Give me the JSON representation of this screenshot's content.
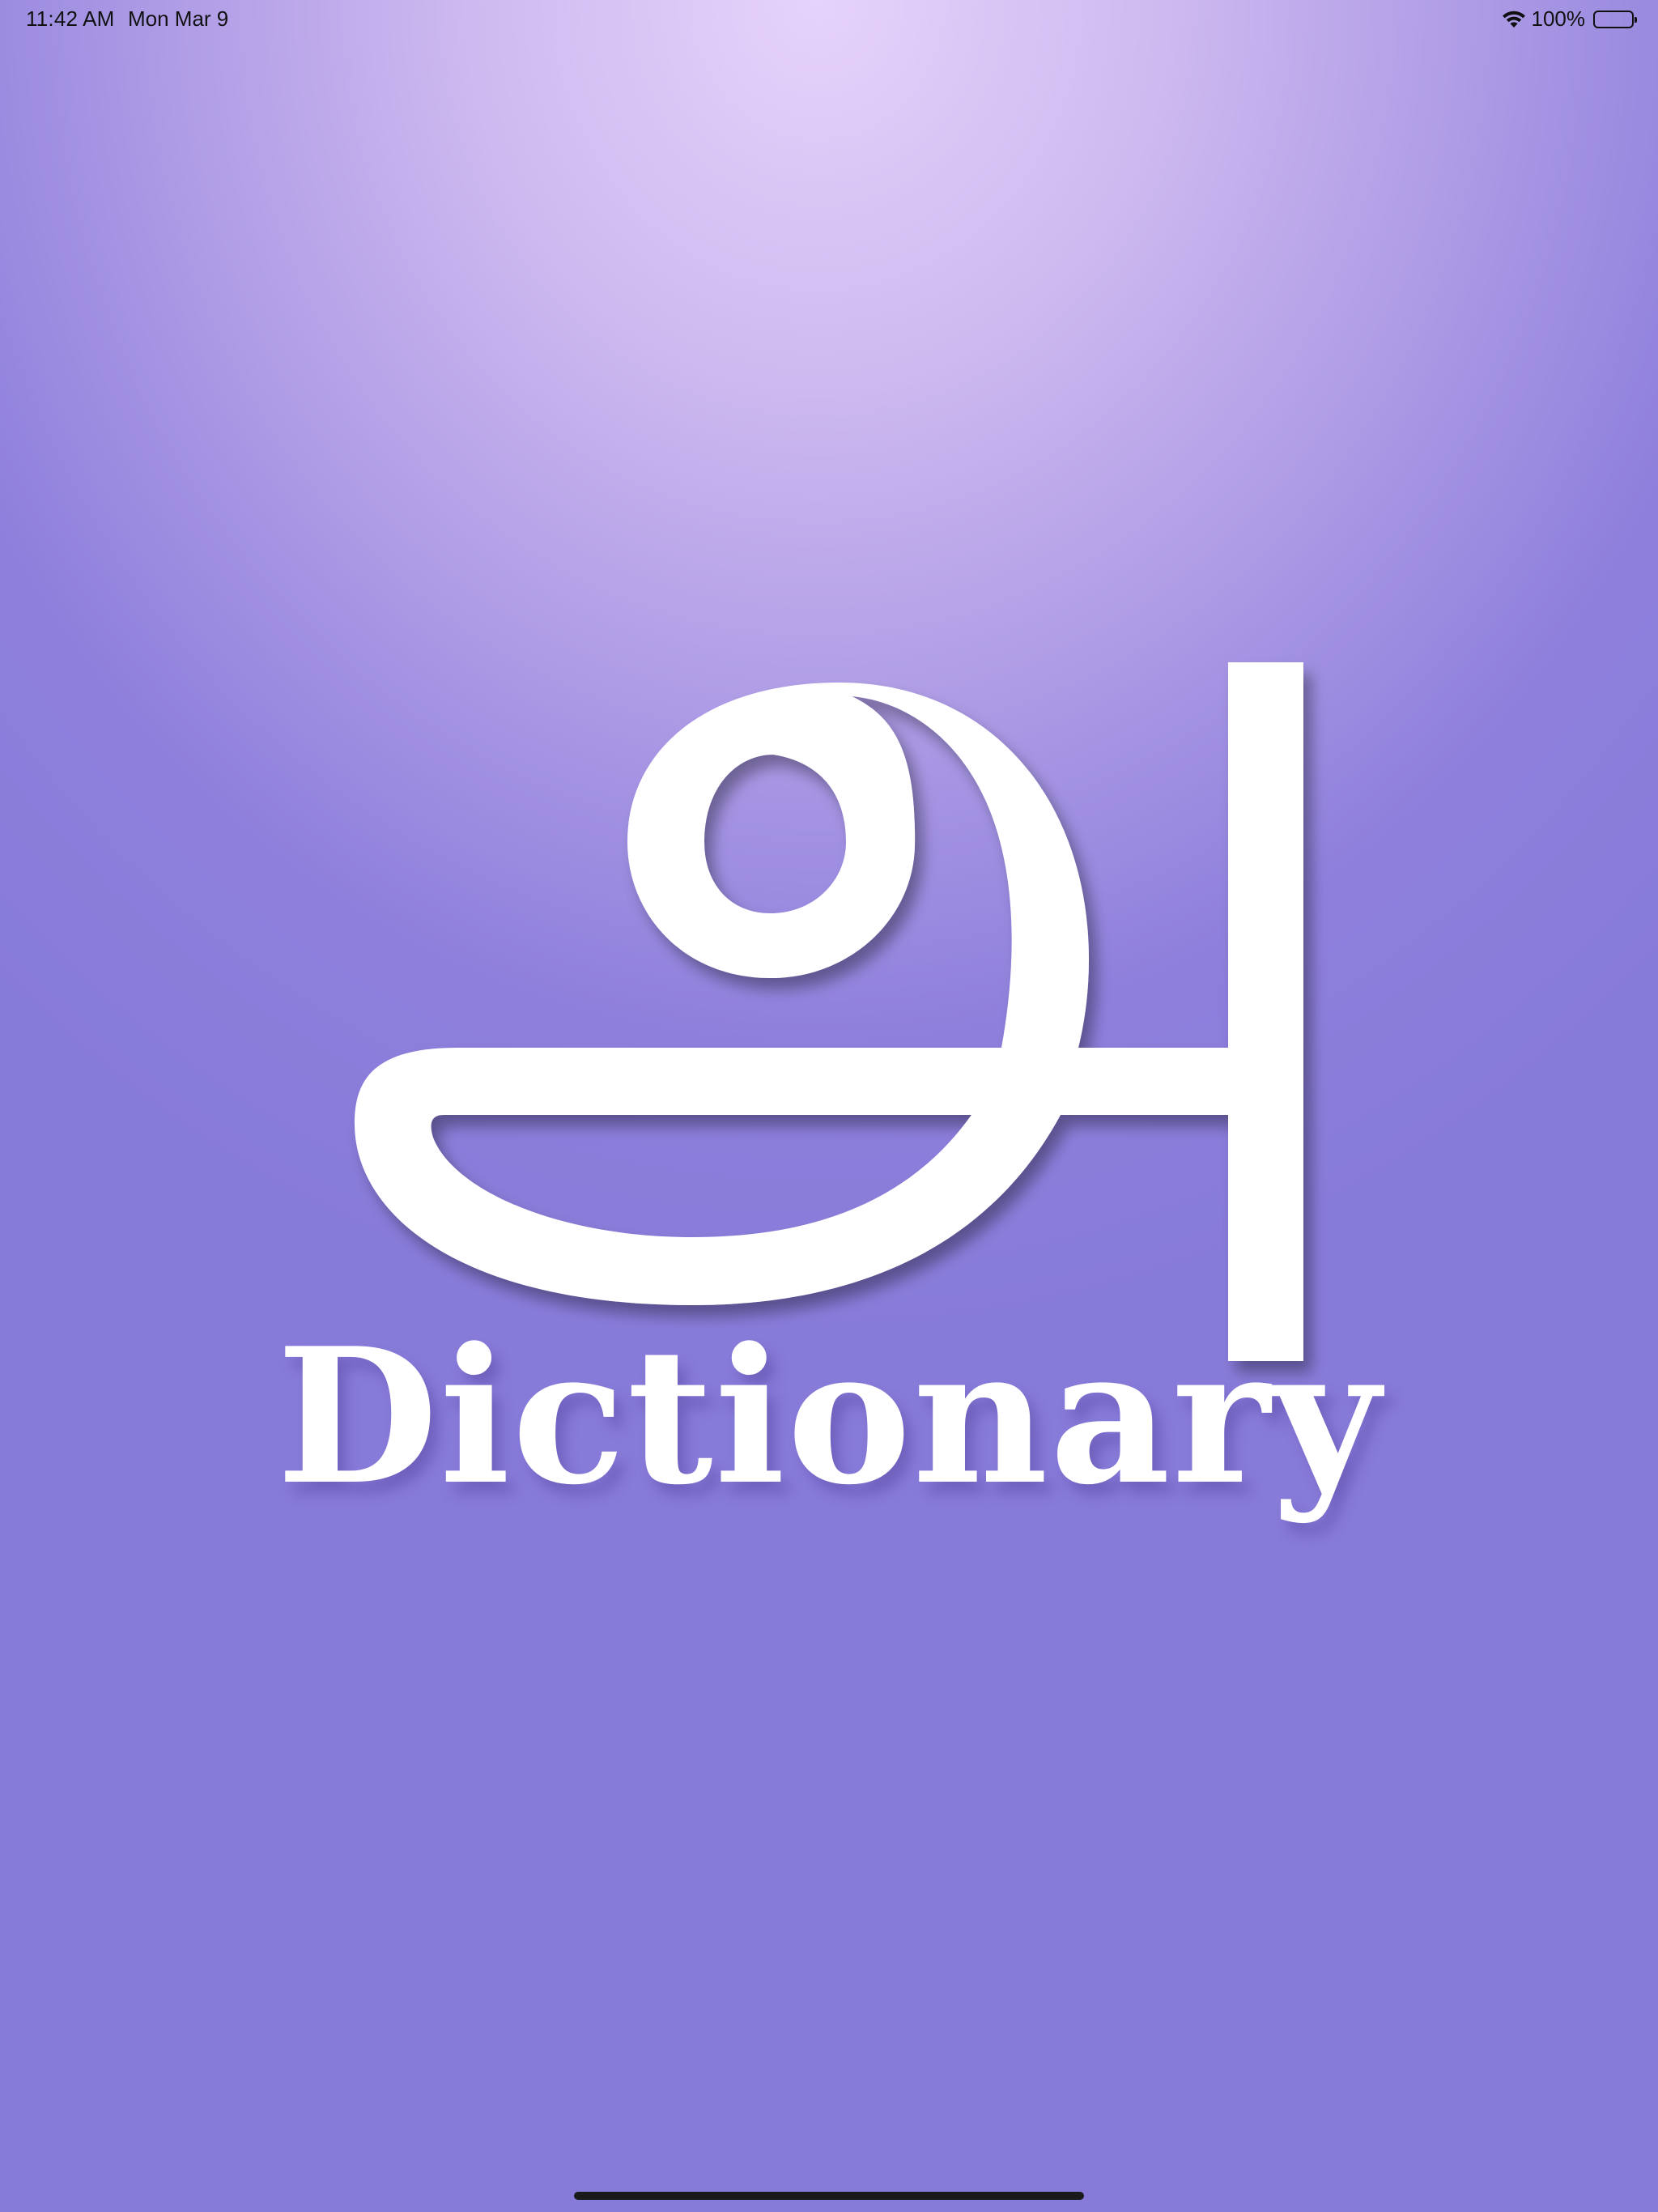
{
  "status_bar": {
    "time": "11:42 AM",
    "date": "Mon Mar 9",
    "battery_percent": "100%",
    "battery_level": 1.0,
    "wifi_icon": "wifi-icon",
    "battery_icon": "battery-icon"
  },
  "splash": {
    "logo_icon": "tamil-letter-a-logo-icon",
    "title": "Dictionary"
  },
  "colors": {
    "background_top": "#e6d3fb",
    "background_bottom": "#877bd9",
    "logo": "#ffffff"
  }
}
